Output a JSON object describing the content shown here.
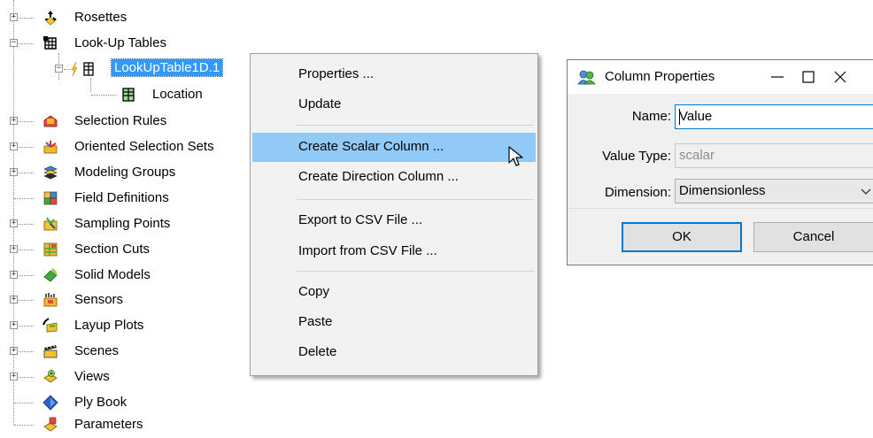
{
  "tree": {
    "items": [
      {
        "label": "Rosettes",
        "icon": "rosettes-icon"
      },
      {
        "label": "Look-Up Tables",
        "icon": "lookup-tables-icon"
      },
      {
        "label": "LookUpTable1D.1",
        "icon": "table-icon"
      },
      {
        "label": "Location",
        "icon": "table-icon"
      },
      {
        "label": "Selection Rules",
        "icon": "selection-rules-icon"
      },
      {
        "label": "Oriented Selection Sets",
        "icon": "oriented-selection-sets-icon"
      },
      {
        "label": "Modeling Groups",
        "icon": "modeling-groups-icon"
      },
      {
        "label": "Field Definitions",
        "icon": "field-definitions-icon"
      },
      {
        "label": "Sampling Points",
        "icon": "sampling-points-icon"
      },
      {
        "label": "Section Cuts",
        "icon": "section-cuts-icon"
      },
      {
        "label": "Solid Models",
        "icon": "solid-models-icon"
      },
      {
        "label": "Sensors",
        "icon": "sensors-icon"
      },
      {
        "label": "Layup Plots",
        "icon": "layup-plots-icon"
      },
      {
        "label": "Scenes",
        "icon": "scenes-icon"
      },
      {
        "label": "Views",
        "icon": "views-icon"
      },
      {
        "label": "Ply Book",
        "icon": "ply-book-icon"
      },
      {
        "label": "Parameters",
        "icon": "parameters-icon"
      }
    ]
  },
  "context_menu": {
    "items": [
      {
        "label": "Properties ..."
      },
      {
        "label": "Update"
      },
      {
        "label": "Create Scalar Column ..."
      },
      {
        "label": "Create Direction Column ..."
      },
      {
        "label": "Export to CSV File ..."
      },
      {
        "label": "Import from CSV File ..."
      },
      {
        "label": "Copy"
      },
      {
        "label": "Paste"
      },
      {
        "label": "Delete"
      }
    ],
    "hovered": "Create Scalar Column ..."
  },
  "dialog": {
    "title": "Column Properties",
    "name_label": "Name:",
    "name_value": "Value",
    "value_type_label": "Value Type:",
    "value_type_value": "scalar",
    "dimension_label": "Dimension:",
    "dimension_value": "Dimensionless",
    "ok_label": "OK",
    "cancel_label": "Cancel"
  },
  "colors": {
    "selection": "#3399ff",
    "menu_hover": "#91c9f7",
    "focus_border": "#0078d7"
  }
}
